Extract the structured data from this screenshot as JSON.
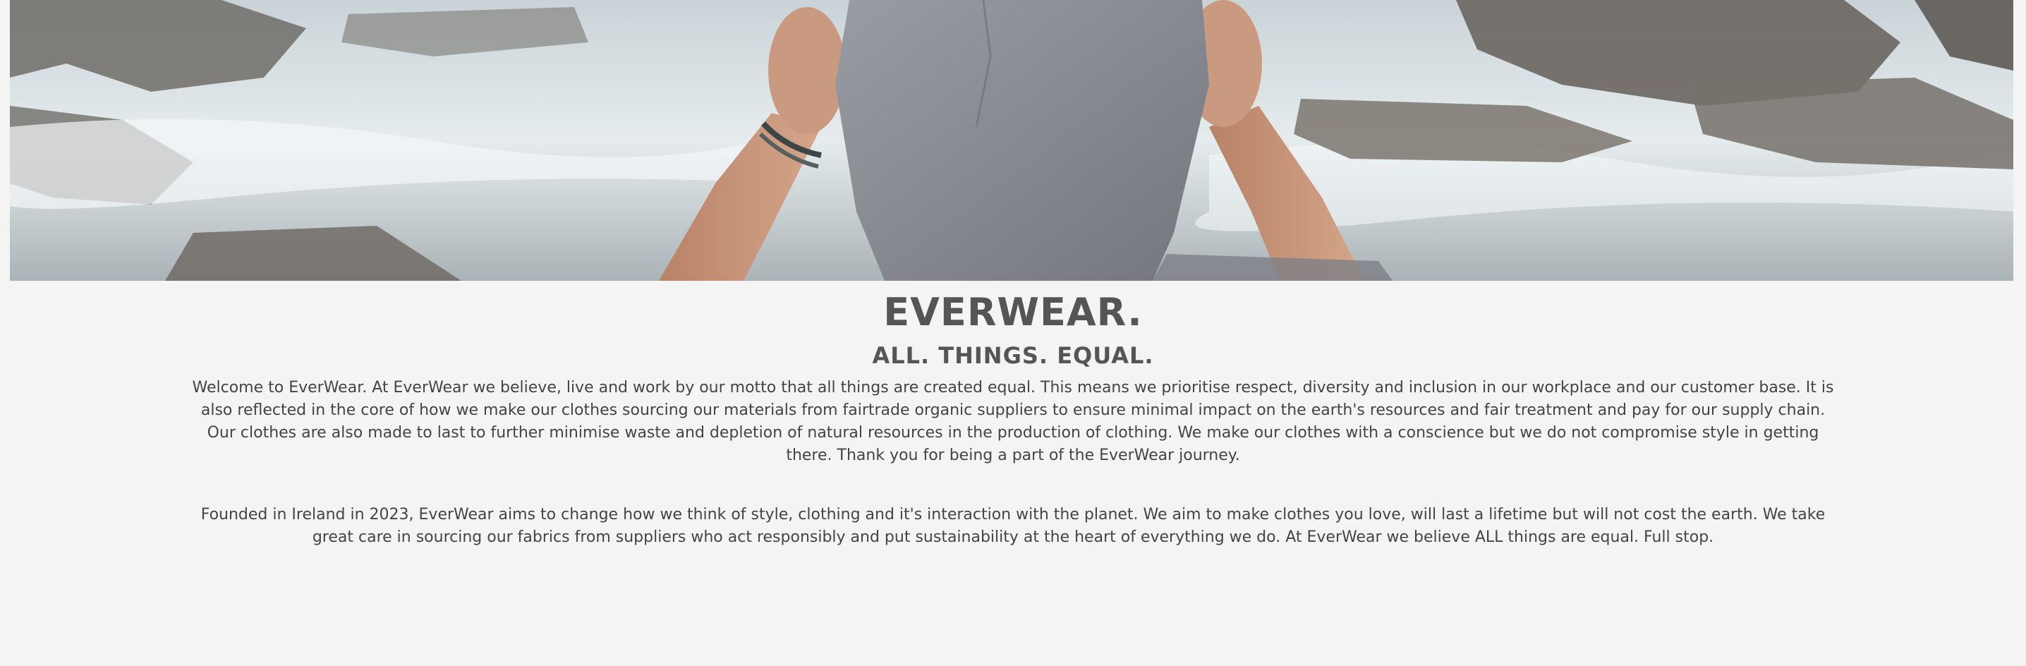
{
  "hero": {
    "image_alt": "Person holding a grey t-shirt in front of a rushing river",
    "colors": {
      "water": "#dde5e8",
      "rock": "#6e6a64",
      "shirt": "#8d8f96",
      "skin": "#c79478"
    }
  },
  "brand": {
    "title": "EVERWEAR.",
    "tagline": "ALL. THINGS. EQUAL."
  },
  "intro": {
    "text": "Welcome to EverWear. At EverWear we believe, live and work by our motto that all things are created equal. This means we prioritise respect, diversity and inclusion in our workplace and our customer base. It is also reflected in the core of how we make our clothes sourcing our materials from fairtrade organic suppliers to ensure minimal impact on the earth's resources and fair treatment and pay for our supply chain. Our clothes are also made to last to further minimise waste and depletion of natural resources in the production of clothing. We make our clothes with a conscience but we do not compromise style in getting there. Thank you for being a part of the EverWear journey."
  },
  "about": {
    "text": "Founded in Ireland in 2023, EverWear aims to change how we think of style, clothing and it's interaction with the planet. We aim to make clothes you love, will last a lifetime but will not cost the earth. We take great care in sourcing our fabrics from suppliers who act responsibly and put sustainability at the heart of everything we do. At EverWear we believe ALL things are equal. Full stop."
  }
}
